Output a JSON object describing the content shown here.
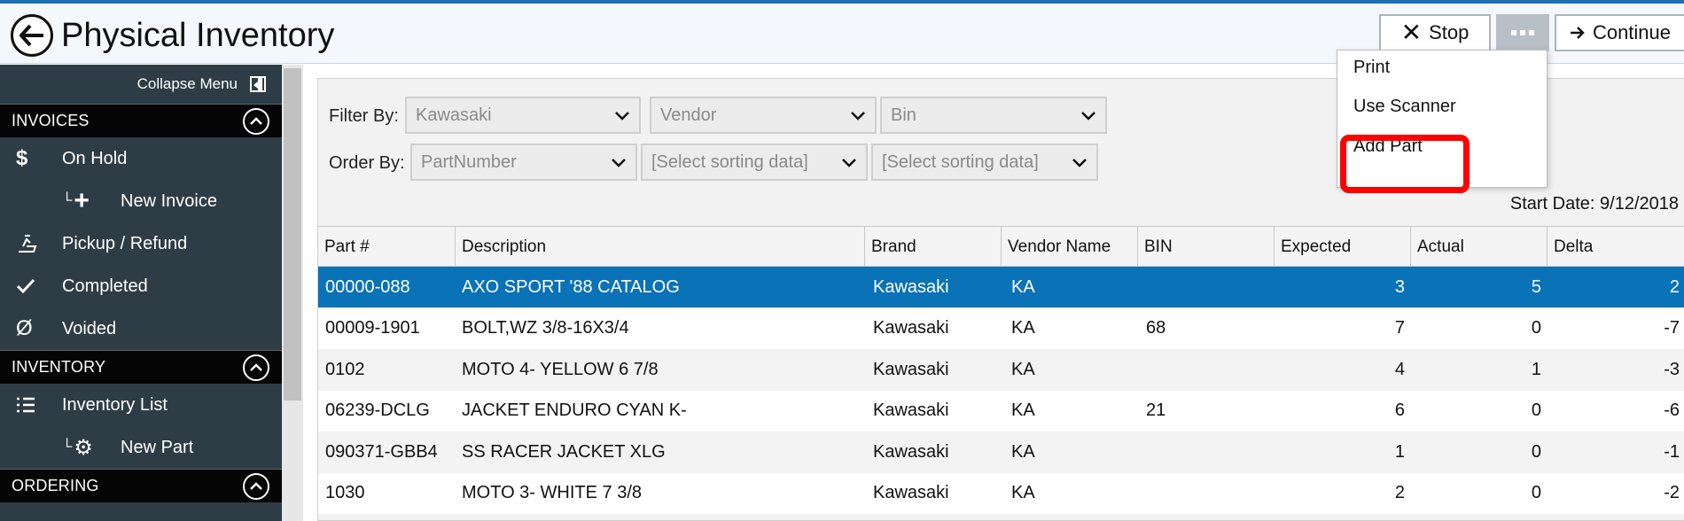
{
  "window": {
    "title": "Physical Inventory",
    "accent_color": "#1e6fb5"
  },
  "toolbar": {
    "stop_label": "Stop",
    "more_icon": "ellipsis-icon",
    "continue_label": "Continue"
  },
  "more_menu": {
    "items": [
      "Print",
      "Use Scanner",
      "Add Part"
    ],
    "highlighted": "Add Part",
    "highlight_color": "#ff0000"
  },
  "sidebar": {
    "collapse_label": "Collapse Menu",
    "sections": [
      {
        "title": "INVOICES",
        "items": [
          {
            "label": "On Hold",
            "icon": "dollar-icon"
          },
          {
            "label": "New Invoice",
            "icon": "plus-icon",
            "sub": true
          },
          {
            "label": "Pickup / Refund",
            "icon": "hand-refund-icon"
          },
          {
            "label": "Completed",
            "icon": "check-icon"
          },
          {
            "label": "Voided",
            "icon": "empty-set-icon"
          }
        ]
      },
      {
        "title": "INVENTORY",
        "items": [
          {
            "label": "Inventory List",
            "icon": "list-icon"
          },
          {
            "label": "New Part",
            "icon": "gear-icon",
            "sub": true
          }
        ]
      },
      {
        "title": "ORDERING",
        "items": []
      }
    ]
  },
  "filters": {
    "filter_by_label": "Filter By:",
    "filter_by": [
      "Kawasaki",
      "Vendor",
      "Bin"
    ],
    "order_by_label": "Order By:",
    "order_by": [
      "PartNumber",
      "[Select sorting data]",
      "[Select sorting data]"
    ]
  },
  "start_date": "Start Date: 9/12/2018",
  "grid": {
    "columns": [
      "Part #",
      "Description",
      "Brand",
      "Vendor Name",
      "BIN",
      "Expected",
      "Actual",
      "Delta"
    ],
    "selected_row": 0,
    "selected_color": "#0a72b7",
    "rows": [
      [
        "00000-088",
        "AXO SPORT '88 CATALOG",
        "Kawasaki",
        "KA",
        "",
        "3",
        "5",
        "2"
      ],
      [
        "00009-1901",
        "BOLT,WZ 3/8-16X3/4",
        "Kawasaki",
        "KA",
        "68",
        "7",
        "0",
        "-7"
      ],
      [
        "0102",
        "MOTO 4- YELLOW 6 7/8",
        "Kawasaki",
        "KA",
        "",
        "4",
        "1",
        "-3"
      ],
      [
        "06239-DCLG",
        "JACKET ENDURO CYAN K-",
        "Kawasaki",
        "KA",
        "21",
        "6",
        "0",
        "-6"
      ],
      [
        "090371-GBB4",
        "SS RACER JACKET XLG",
        "Kawasaki",
        "KA",
        "",
        "1",
        "0",
        "-1"
      ],
      [
        "1030",
        "MOTO 3- WHITE 7 3/8",
        "Kawasaki",
        "KA",
        "",
        "2",
        "0",
        "-2"
      ]
    ]
  }
}
